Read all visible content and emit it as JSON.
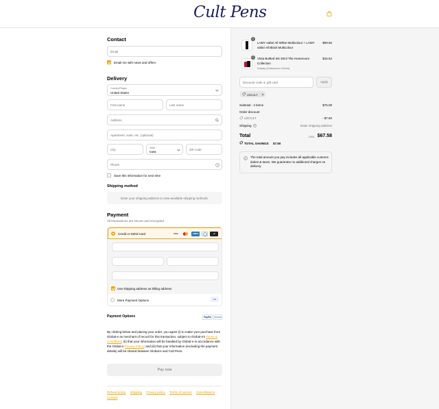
{
  "brand": {
    "logo_text": "Cult Pens",
    "accent_color": "#f0a500"
  },
  "header": {
    "bag_icon": "shopping-bag-icon"
  },
  "contact": {
    "heading": "Contact",
    "email_placeholder": "Email",
    "news_label": "Email me with news and offers",
    "news_checked": true
  },
  "delivery": {
    "heading": "Delivery",
    "country_label": "Country/Region",
    "country_value": "United States",
    "first_name": "First name",
    "last_name": "Last name",
    "address": "Address",
    "apartment": "Apartment, suite, etc. (optional)",
    "city": "City",
    "state_label": "State",
    "state_value": "Iowa",
    "zip": "ZIP code",
    "phone": "Phone",
    "save_label": "Save this information for next time",
    "save_checked": false
  },
  "shipping_method": {
    "heading": "Shipping method",
    "message": "Enter your shipping address to view available shipping methods."
  },
  "payment": {
    "heading": "Payment",
    "subtitle": "All transactions are secure and encrypted.",
    "card_option": "Credit or Debit Card",
    "card_brands": [
      "VISA",
      "MC",
      "AMEX",
      "DINERS",
      "+2"
    ],
    "billing_label": "Use shipping address as billing address",
    "billing_checked": true,
    "more_options": "More Payment Options",
    "more_dots": "•••"
  },
  "payment_options": {
    "heading": "Payment Options",
    "badges": [
      "PayPal",
      "Venmo"
    ]
  },
  "legal": {
    "text1": "By clicking below and placing your order, you agree (i) to make your purchase from Global-e as merchant of record for this transaction, subject to Global-e's ",
    "terms": "Terms & Conditions",
    "text2": "; (ii) that your information will be handled by Global-e in accordance with the Global-e ",
    "privacy": "Privacy Policy",
    "text3": "; and (iii) that your information (excluding the payment details) will be shared between Global-e and Cult Pens."
  },
  "pay_button": "Pay now",
  "footer_links": [
    "Refund policy",
    "Shipping",
    "Privacy policy",
    "Terms of service",
    "Cancellations",
    "Contact"
  ],
  "cart": {
    "items": [
      {
        "qty": "1",
        "title": "LAMY safari All White Multicolour + LAMY safari All Black Multicolour",
        "subtitle": "",
        "price": "$59.56"
      },
      {
        "qty": "1",
        "title": "Vinta Bottled Ink 30ml The Homeroom Collection",
        "subtitle": "Sulpay (Classroom Green)",
        "price": "$15.52"
      }
    ],
    "discount_placeholder": "Discount code or gift card",
    "apply_label": "Apply",
    "applied_code": "USCULT",
    "subtotal_label": "Subtotal · 2 items",
    "subtotal_value": "$75.08",
    "order_discount_label": "Order discount",
    "code_label": "USCULT",
    "code_value": "- $7.50",
    "shipping_label": "Shipping",
    "shipping_value": "Enter shipping address",
    "total_label": "Total",
    "total_currency": "USD",
    "total_value": "$67.58",
    "savings_label": "TOTAL SAVINGS",
    "savings_value": "$7.50",
    "notice": "The total amount you pay includes all applicable customs duties & taxes. We guarantee no additional charges on delivery."
  }
}
